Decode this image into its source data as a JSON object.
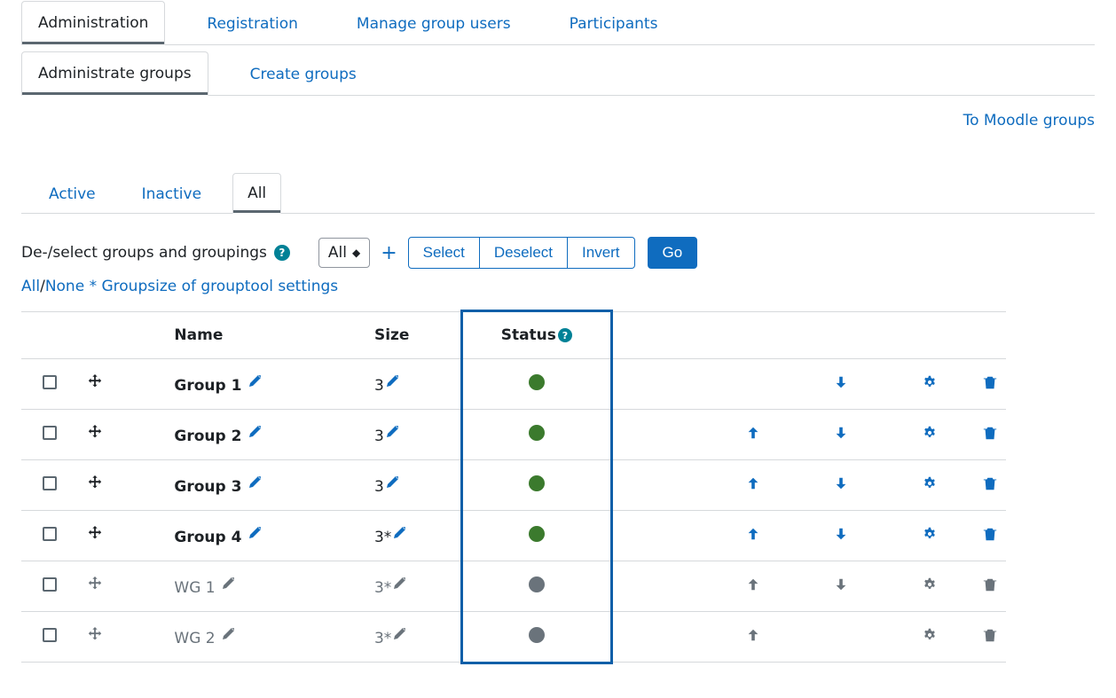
{
  "tabs_primary": {
    "items": [
      {
        "label": "Administration",
        "active": true
      },
      {
        "label": "Registration",
        "active": false
      },
      {
        "label": "Manage group users",
        "active": false
      },
      {
        "label": "Participants",
        "active": false
      }
    ]
  },
  "tabs_secondary": {
    "items": [
      {
        "label": "Administrate groups",
        "active": true
      },
      {
        "label": "Create groups",
        "active": false
      }
    ]
  },
  "right_link": "To Moodle groups",
  "filter_tabs": {
    "items": [
      {
        "label": "Active",
        "active": false
      },
      {
        "label": "Inactive",
        "active": false
      },
      {
        "label": "All",
        "active": true
      }
    ]
  },
  "toolbar": {
    "label": "De-/select groups and groupings",
    "dropdown_value": "All",
    "buttons": {
      "select": "Select",
      "deselect": "Deselect",
      "invert": "Invert",
      "go": "Go"
    }
  },
  "legend": {
    "all": "All",
    "none": "None",
    "note": " * Groupsize of grouptool settings"
  },
  "table": {
    "headers": {
      "name": "Name",
      "size": "Size",
      "status": "Status"
    },
    "rows": [
      {
        "name": "Group 1",
        "size": "3",
        "status": "green",
        "active": true,
        "up": false,
        "down": true
      },
      {
        "name": "Group 2",
        "size": "3",
        "status": "green",
        "active": true,
        "up": true,
        "down": true
      },
      {
        "name": "Group 3",
        "size": "3",
        "status": "green",
        "active": true,
        "up": true,
        "down": true
      },
      {
        "name": "Group 4",
        "size": "3*",
        "status": "green",
        "active": true,
        "up": true,
        "down": true
      },
      {
        "name": "WG 1",
        "size": "3*",
        "status": "grey",
        "active": false,
        "up": true,
        "down": true
      },
      {
        "name": "WG 2",
        "size": "3*",
        "status": "grey",
        "active": false,
        "up": true,
        "down": false
      }
    ]
  }
}
